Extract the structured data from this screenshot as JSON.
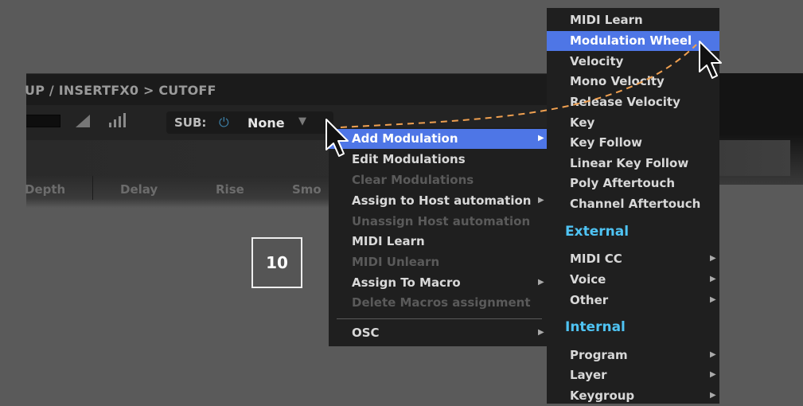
{
  "breadcrumb": "UP / INSERTFX0 > CUTOFF",
  "control_row": {
    "sub_label": "SUB:",
    "sub_value": "None"
  },
  "columns": [
    "Depth",
    "Delay",
    "Rise",
    "Smo"
  ],
  "step_badge": "10",
  "context_menu": {
    "items": [
      {
        "label": "Add Modulation",
        "enabled": true,
        "highlighted": true,
        "submenu": true
      },
      {
        "label": "Edit Modulations",
        "enabled": true,
        "highlighted": false,
        "submenu": false
      },
      {
        "label": "Clear Modulations",
        "enabled": false,
        "highlighted": false,
        "submenu": false
      },
      {
        "label": "Assign to Host automation",
        "enabled": true,
        "highlighted": false,
        "submenu": true
      },
      {
        "label": "Unassign Host automation",
        "enabled": false,
        "highlighted": false,
        "submenu": false
      },
      {
        "label": "MIDI Learn",
        "enabled": true,
        "highlighted": false,
        "submenu": false
      },
      {
        "label": "MIDI Unlearn",
        "enabled": false,
        "highlighted": false,
        "submenu": false
      },
      {
        "label": "Assign To Macro",
        "enabled": true,
        "highlighted": false,
        "submenu": true
      },
      {
        "label": "Delete Macros assignment",
        "enabled": false,
        "highlighted": false,
        "submenu": false
      }
    ],
    "osc": {
      "label": "OSC",
      "submenu": true
    }
  },
  "modulation_submenu": {
    "items": [
      {
        "label": "MIDI Learn",
        "highlighted": false
      },
      {
        "label": "Modulation Wheel",
        "highlighted": true
      },
      {
        "label": "Velocity",
        "highlighted": false
      },
      {
        "label": "Mono Velocity",
        "highlighted": false
      },
      {
        "label": "Release Velocity",
        "highlighted": false
      },
      {
        "label": "Key",
        "highlighted": false
      },
      {
        "label": "Key Follow",
        "highlighted": false
      },
      {
        "label": "Linear Key Follow",
        "highlighted": false
      },
      {
        "label": "Poly Aftertouch",
        "highlighted": false
      },
      {
        "label": "Channel Aftertouch",
        "highlighted": false
      }
    ],
    "external": {
      "title": "External",
      "items": [
        {
          "label": "MIDI CC",
          "submenu": true
        },
        {
          "label": "Voice",
          "submenu": true
        },
        {
          "label": "Other",
          "submenu": true
        }
      ]
    },
    "internal": {
      "title": "Internal",
      "items": [
        {
          "label": "Program",
          "submenu": true
        },
        {
          "label": "Layer",
          "submenu": true
        },
        {
          "label": "Keygroup",
          "submenu": true
        }
      ]
    }
  },
  "colors": {
    "highlight": "#4e76e6",
    "section_title": "#4fc3f3",
    "background": "#5a5a5a",
    "menu_bg": "#1f1f1f",
    "arrow_line": "#f0a050"
  },
  "icons": [
    "power-icon",
    "dropdown-caret-icon",
    "level-triangle-icon",
    "bars-icon",
    "submenu-arrow-icon",
    "mouse-pointer-icon"
  ]
}
